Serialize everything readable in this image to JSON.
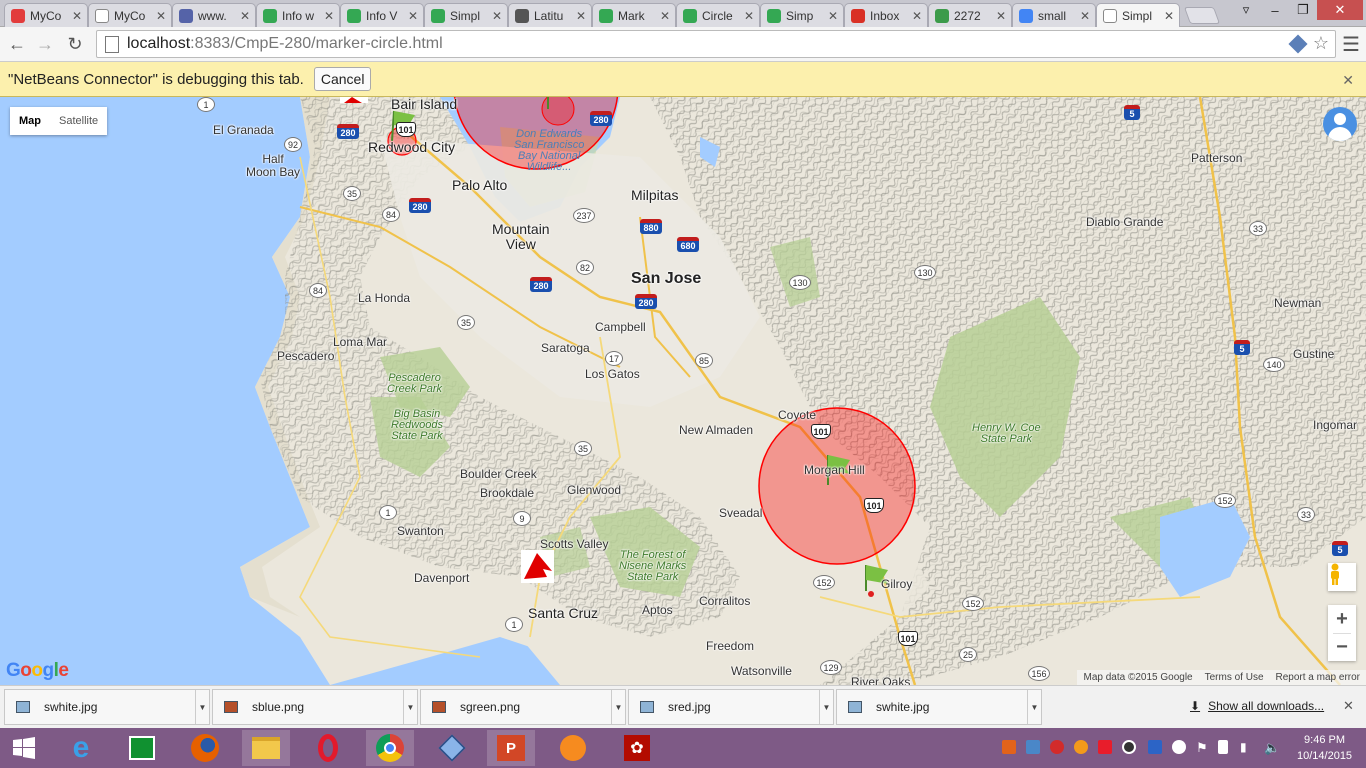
{
  "browser": {
    "tabs": [
      {
        "label": "MyCo",
        "favicon_color": "#e23c3c"
      },
      {
        "label": "MyCo",
        "favicon_color": "#ffffff"
      },
      {
        "label": "www.",
        "favicon_color": "#5563a8"
      },
      {
        "label": "Info w",
        "favicon_color": "#34a853"
      },
      {
        "label": "Info V",
        "favicon_color": "#34a853"
      },
      {
        "label": "Simpl",
        "favicon_color": "#34a853"
      },
      {
        "label": "Latitu",
        "favicon_color": "#555555"
      },
      {
        "label": "Mark",
        "favicon_color": "#34a853"
      },
      {
        "label": "Circle",
        "favicon_color": "#34a853"
      },
      {
        "label": "Simp",
        "favicon_color": "#34a853"
      },
      {
        "label": "Inbox",
        "favicon_color": "#d93025"
      },
      {
        "label": "2272",
        "favicon_color": "#3c9b4a"
      },
      {
        "label": "small",
        "favicon_color": "#4285f4"
      },
      {
        "label": "Simpl",
        "favicon_color": "#ffffff"
      }
    ],
    "active_tab": 13,
    "url_host": "localhost",
    "url_path": ":8383/CmpE-280/marker-circle.html",
    "infobar_text": "\"NetBeans Connector\" is debugging this tab.",
    "infobar_cancel": "Cancel"
  },
  "map": {
    "map_type_map": "Map",
    "map_type_satellite": "Satellite",
    "logo_text": "Google",
    "attribution": [
      "Map data ©2015 Google",
      "Terms of Use",
      "Report a map error"
    ],
    "zoom_in": "+",
    "zoom_out": "−",
    "labels": {
      "el_granada": "El Granada",
      "bair_island": "Bair Island",
      "redwood_city": "Redwood City",
      "half_moon_bay": "Half\nMoon Bay",
      "palo_alto": "Palo Alto",
      "milpitas": "Milpitas",
      "mountain_view": "Mountain\nView",
      "san_jose": "San Jose",
      "la_honda": "La Honda",
      "campbell": "Campbell",
      "pescadero": "Pescadero",
      "loma_mar": "Loma Mar",
      "saratoga": "Saratoga",
      "los_gatos": "Los Gatos",
      "coyote": "Coyote",
      "new_almaden": "New Almaden",
      "morgan_hill": "Morgan Hill",
      "boulder_creek": "Boulder Creek",
      "brookdale": "Brookdale",
      "glenwood": "Glenwood",
      "swanton": "Swanton",
      "sveadal": "Sveadal",
      "scotts_valley": "Scotts Valley",
      "davenport": "Davenport",
      "santa_cruz": "Santa Cruz",
      "aptos": "Aptos",
      "corralitos": "Corralitos",
      "gilroy": "Gilroy",
      "freedom": "Freedom",
      "watsonville": "Watsonville",
      "river_oaks": "River Oaks",
      "patterson": "Patterson",
      "diablo_grande": "Diablo Grande",
      "newman": "Newman",
      "gustine": "Gustine",
      "ingomar": "Ingomar",
      "pescadero_park": "Pescadero\nCreek Park",
      "big_basin": "Big Basin\nRedwoods\nState Park",
      "forest_nisene": "The Forest of\nNisene Marks\nState Park",
      "henry_coe": "Henry W. Coe\nState Park",
      "don_edwards": "Don Edwards\nSan Francisco\nBay National\nWildlife..."
    },
    "shields": {
      "i280a": "280",
      "i280b": "280",
      "i280c": "280",
      "i280d": "280",
      "i880": "880",
      "i680": "680",
      "i5a": "5",
      "i5b": "5",
      "i5c": "5",
      "us101a": "101",
      "us101b": "101",
      "us101c": "101",
      "us101d": "101",
      "s92": "92",
      "s35a": "35",
      "s35b": "35",
      "s35c": "35",
      "s84": "84",
      "s237": "237",
      "s82": "82",
      "s85": "85",
      "s17": "17",
      "s9": "9",
      "s1a": "1",
      "s1b": "1",
      "s1c": "1",
      "s130a": "130",
      "s130b": "130",
      "s33": "33",
      "s140": "140",
      "s152a": "152",
      "s152b": "152",
      "s152c": "152",
      "s129": "129",
      "s25": "25",
      "s156": "156"
    },
    "circle_color": "#ff0000"
  },
  "downloads": {
    "items": [
      {
        "name": "swhite.jpg",
        "icon_color": "#8fb4d6"
      },
      {
        "name": "sblue.png",
        "icon_color": "#b5502a"
      },
      {
        "name": "sgreen.png",
        "icon_color": "#b5502a"
      },
      {
        "name": "sred.jpg",
        "icon_color": "#8fb4d6"
      },
      {
        "name": "swhite.jpg",
        "icon_color": "#8fb4d6"
      }
    ],
    "show_all": "Show all downloads..."
  },
  "taskbar": {
    "time": "9:46 PM",
    "date": "10/14/2015"
  }
}
